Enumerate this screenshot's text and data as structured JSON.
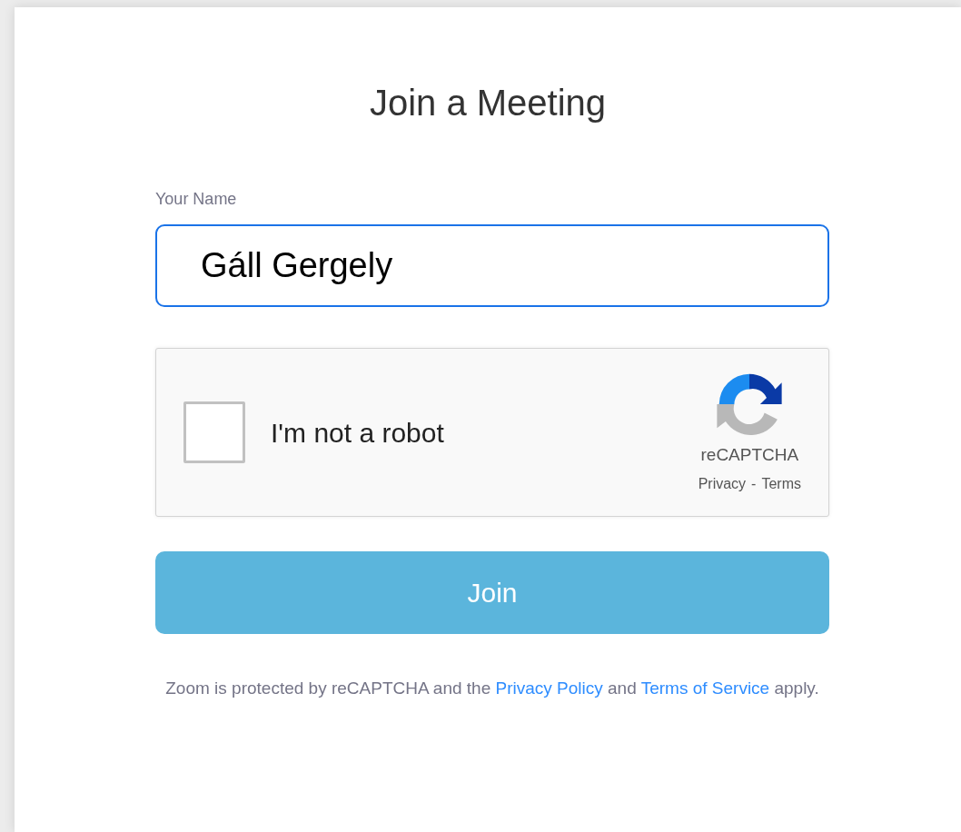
{
  "title": "Join a Meeting",
  "name_field": {
    "label": "Your Name",
    "value": "Gáll Gergely",
    "focused": true
  },
  "captcha": {
    "label": "I'm not a robot",
    "checked": false,
    "brand": "reCAPTCHA",
    "privacy": "Privacy",
    "separator": "-",
    "terms": "Terms"
  },
  "join_button": "Join",
  "footer": [
    {
      "kind": "text",
      "text": "Zoom is protected by reCAPTCHA and the "
    },
    {
      "kind": "link",
      "text": "Privacy Policy"
    },
    {
      "kind": "text",
      "text": " and "
    },
    {
      "kind": "link",
      "text": "Terms of Service"
    },
    {
      "kind": "text",
      "text": " apply."
    }
  ]
}
